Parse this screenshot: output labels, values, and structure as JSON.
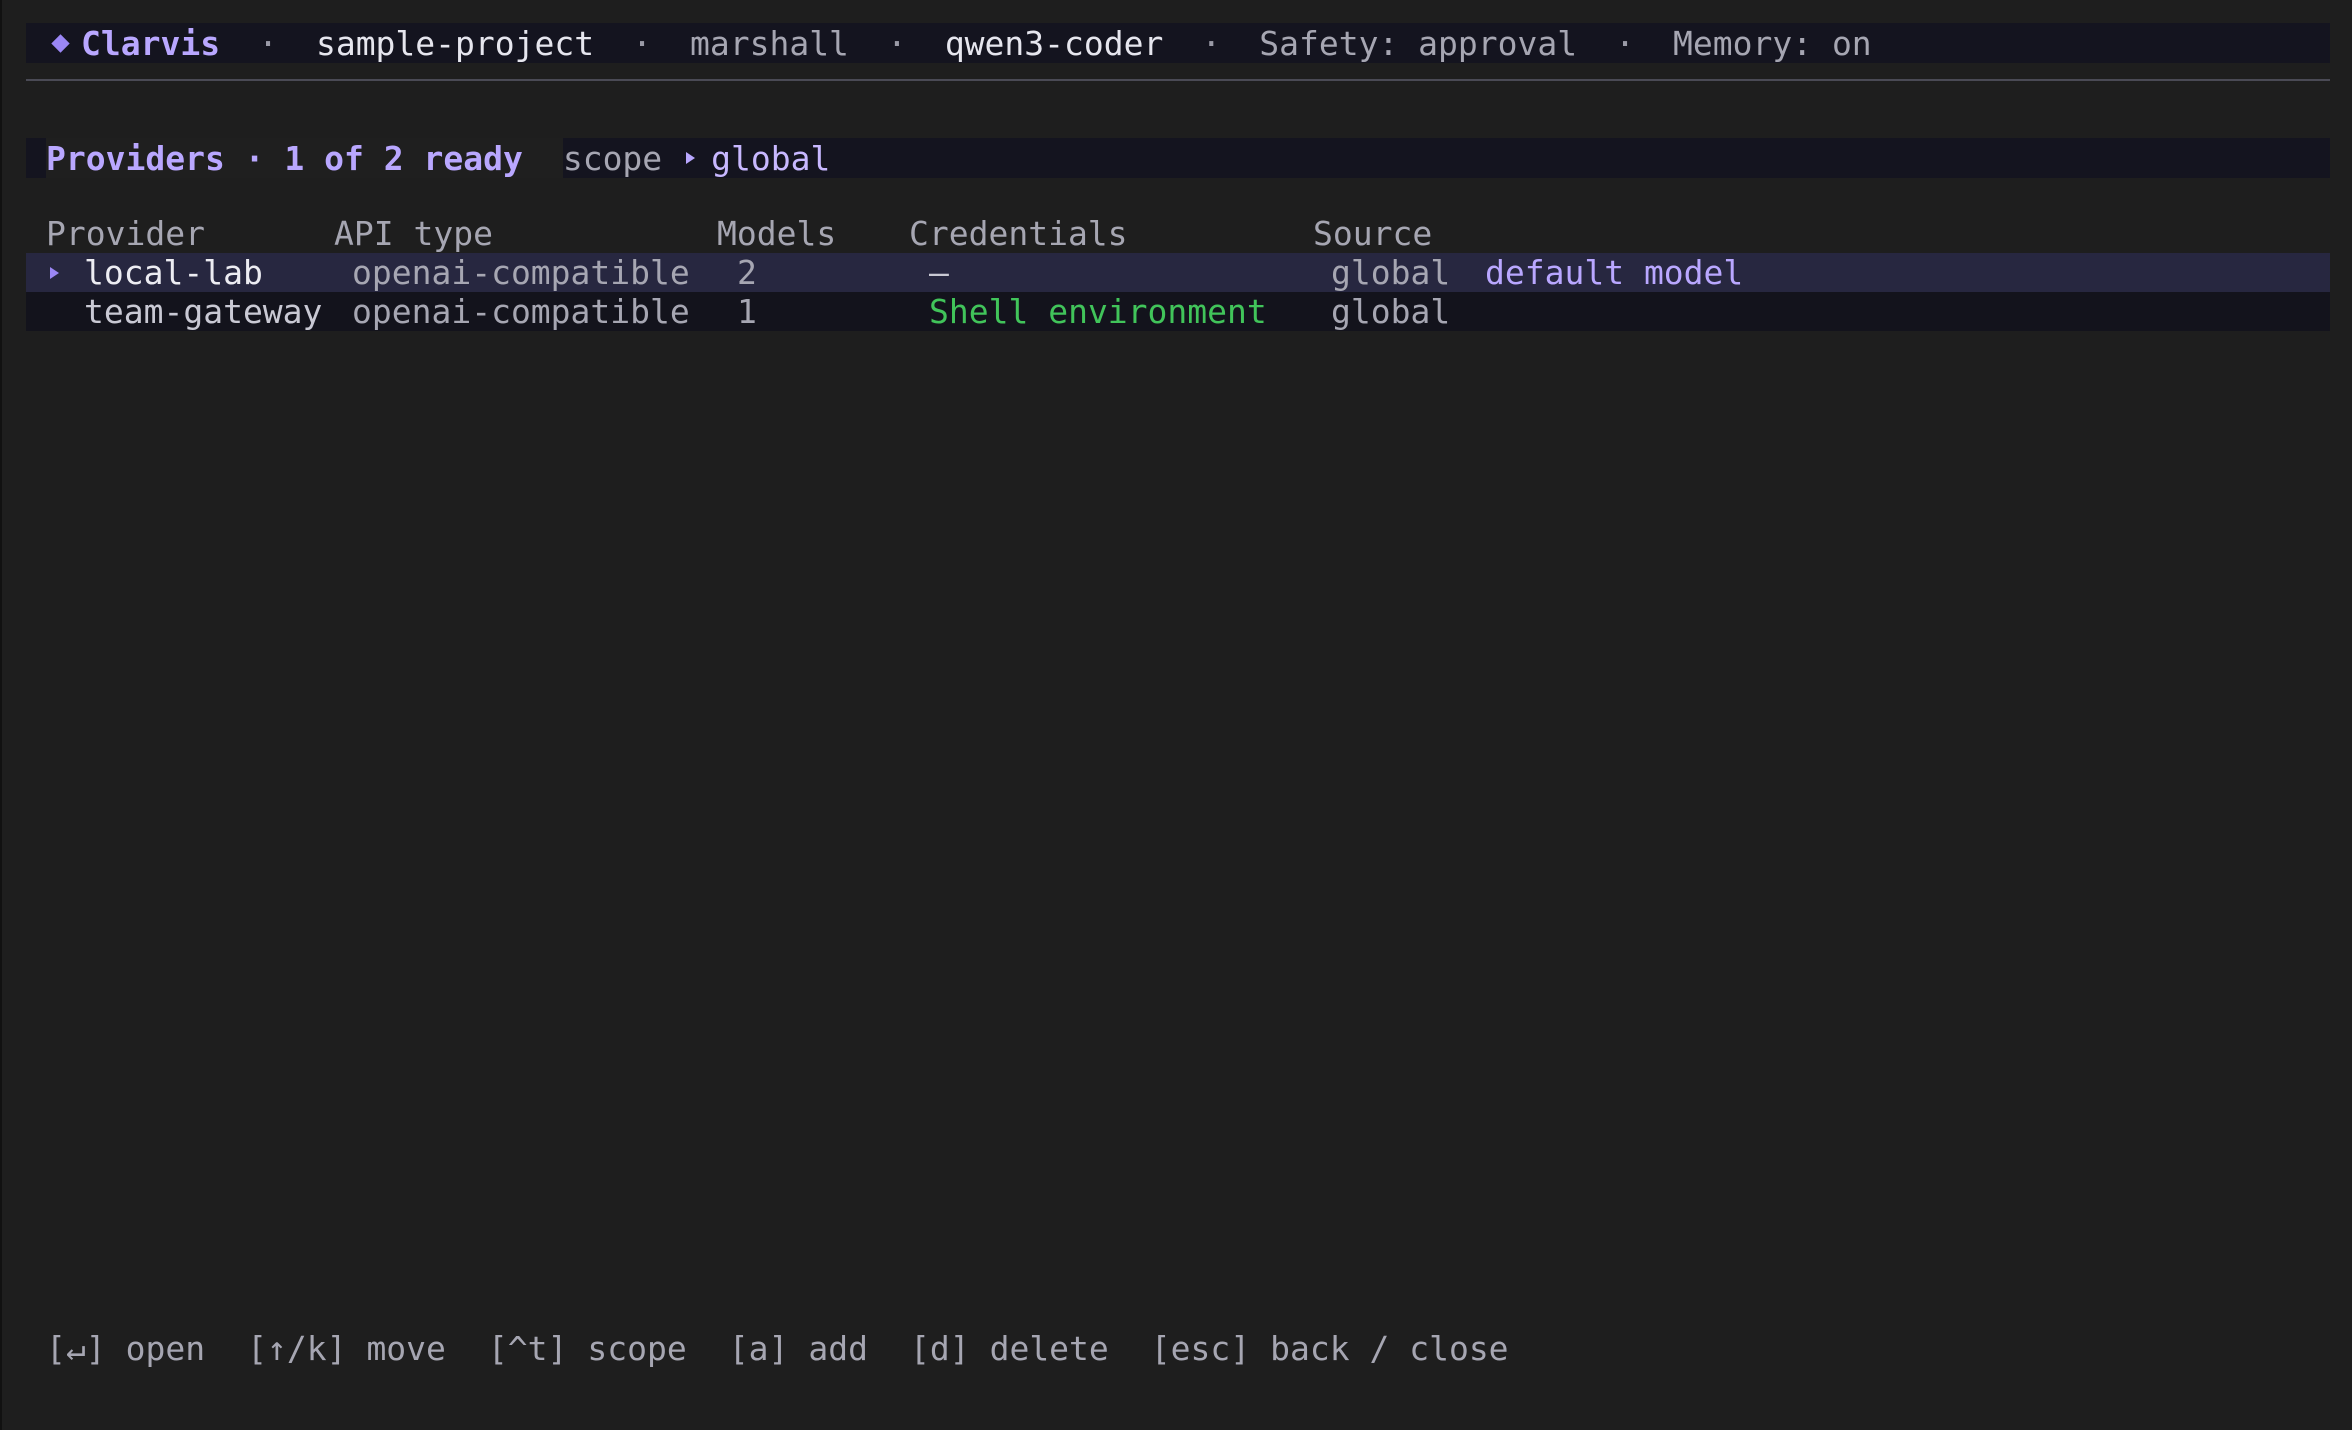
{
  "topbar": {
    "app_name": "Clarvis",
    "separator": "·",
    "project": "sample-project",
    "user": "marshall",
    "model": "qwen3-coder",
    "safety": "Safety: approval",
    "memory": "Memory: on"
  },
  "icons": {
    "brand": "diamond-icon",
    "scope_caret": "caret-right-icon",
    "row_caret": "caret-right-icon"
  },
  "colors": {
    "accent": "#b9a7ff",
    "background": "#1e1e1e",
    "bar_background": "#14141f",
    "selected_row": "#272740",
    "success": "#41c45a"
  },
  "panel": {
    "title": "Providers · 1 of 2 ready",
    "scope_label": "scope",
    "scope_value": "global"
  },
  "table": {
    "headers": {
      "provider": "Provider",
      "api_type": "API type",
      "models": "Models",
      "credentials": "Credentials",
      "source": "Source"
    },
    "rows": [
      {
        "provider": "local-lab",
        "api_type": "openai-compatible",
        "models": "2",
        "credentials": "–",
        "source": "global",
        "tag": "default model",
        "selected": true
      },
      {
        "provider": "team-gateway",
        "api_type": "openai-compatible",
        "models": "1",
        "credentials": "Shell environment",
        "source": "global",
        "tag": "",
        "selected": false
      }
    ]
  },
  "footer": {
    "hints": [
      {
        "key": "[↵]",
        "label": "open"
      },
      {
        "key": "[↑/k]",
        "label": "move"
      },
      {
        "key": "[^t]",
        "label": "scope"
      },
      {
        "key": "[a]",
        "label": "add"
      },
      {
        "key": "[d]",
        "label": "delete"
      },
      {
        "key": "[esc]",
        "label": "back / close"
      }
    ]
  }
}
